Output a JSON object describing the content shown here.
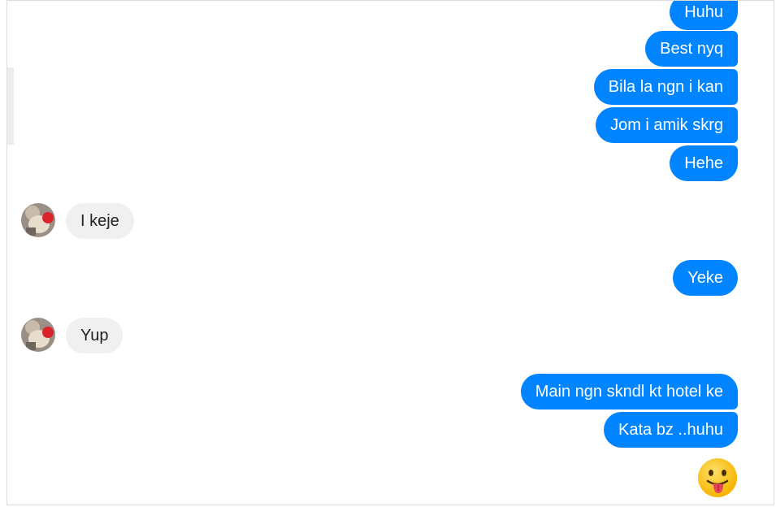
{
  "messages": [
    {
      "dir": "out",
      "text": "Huhu"
    },
    {
      "dir": "out",
      "text": "Best nyq"
    },
    {
      "dir": "out",
      "text": "Bila la ngn i kan"
    },
    {
      "dir": "out",
      "text": "Jom i amik skrg"
    },
    {
      "dir": "out",
      "text": "Hehe"
    },
    {
      "dir": "in",
      "text": "I keje"
    },
    {
      "dir": "out",
      "text": "Yeke"
    },
    {
      "dir": "in",
      "text": "Yup"
    },
    {
      "dir": "out",
      "text": "Main ngn skndl kt hotel ke"
    },
    {
      "dir": "out",
      "text": "Kata bz ..huhu"
    }
  ],
  "sticker": {
    "icon": "tongue-out-emoji-icon"
  },
  "colors": {
    "outgoing_bubble": "#0084ff",
    "incoming_bubble": "#f1f0f0",
    "emoji_face": "#ffcc33"
  }
}
